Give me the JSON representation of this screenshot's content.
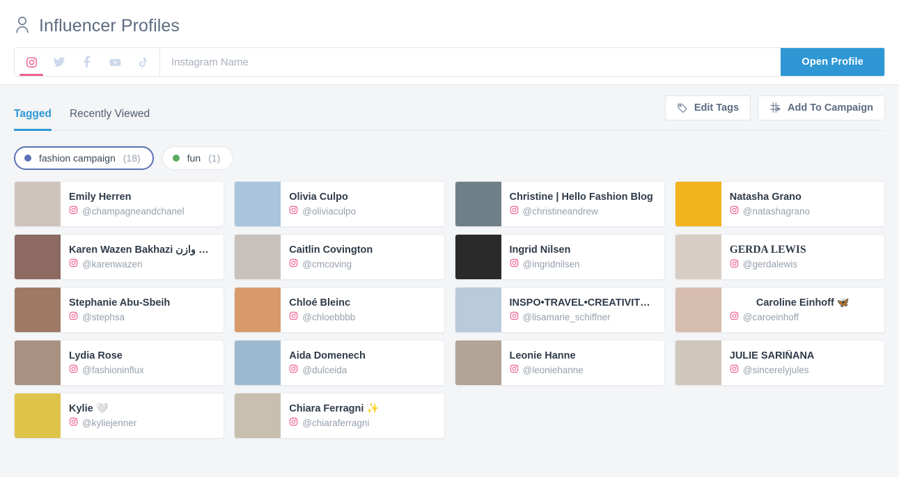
{
  "header": {
    "title": "Influencer Profiles",
    "title_icon": "person-icon"
  },
  "search": {
    "placeholder": "Instagram Name",
    "value": "",
    "open_profile_label": "Open Profile",
    "accent_color": "#2e97d4",
    "networks": [
      {
        "name": "instagram",
        "label": "Instagram",
        "active": true,
        "color": "#f06292"
      },
      {
        "name": "twitter",
        "label": "Twitter",
        "active": false,
        "color": "#ccd8ea"
      },
      {
        "name": "facebook",
        "label": "Facebook",
        "active": false,
        "color": "#ccd8ea"
      },
      {
        "name": "youtube",
        "label": "YouTube",
        "active": false,
        "color": "#ccd8ea"
      },
      {
        "name": "tiktok",
        "label": "TikTok",
        "active": false,
        "color": "#ccd8ea"
      }
    ]
  },
  "tabs": [
    {
      "label": "Tagged",
      "active": true
    },
    {
      "label": "Recently Viewed",
      "active": false
    }
  ],
  "actions": [
    {
      "label": "Edit Tags",
      "icon": "tag-icon"
    },
    {
      "label": "Add To Campaign",
      "icon": "campaign-icon"
    }
  ],
  "tag_filters": [
    {
      "label": "fashion campaign",
      "count": "(18)",
      "color": "#5a6fb5",
      "selected": true
    },
    {
      "label": "fun",
      "count": "(1)",
      "color": "#5cab62",
      "selected": false
    }
  ],
  "profiles": [
    {
      "name": "Emily Herren",
      "handle": "@champagneandchanel",
      "network_icon": "instagram-icon",
      "style": "normal",
      "avatar": "#cfc4bd"
    },
    {
      "name": "Olivia Culpo",
      "handle": "@oliviaculpo",
      "network_icon": "instagram-icon",
      "style": "normal",
      "avatar": "#a9c4dc"
    },
    {
      "name": "Christine | Hello Fashion Blog",
      "handle": "@christineandrew",
      "network_icon": "instagram-icon",
      "style": "normal",
      "avatar": "#6f7f88"
    },
    {
      "name": "Natasha Grano",
      "handle": "@natashagrano",
      "network_icon": "instagram-icon",
      "style": "normal",
      "avatar": "#f2b31c"
    },
    {
      "name": "Karen Wazen Bakhazi كارن وازن...",
      "handle": "@karenwazen",
      "network_icon": "instagram-icon",
      "style": "normal",
      "avatar": "#8c6a62"
    },
    {
      "name": "Caitlin Covington",
      "handle": "@cmcoving",
      "network_icon": "instagram-icon",
      "style": "normal",
      "avatar": "#c8c0bb"
    },
    {
      "name": "Ingrid Nilsen",
      "handle": "@ingridnilsen",
      "network_icon": "instagram-icon",
      "style": "normal",
      "avatar": "#2a2a2a"
    },
    {
      "name": "GERDA LEWIS",
      "handle": "@gerdalewis",
      "network_icon": "instagram-icon",
      "style": "serif",
      "avatar": "#d8cdc4"
    },
    {
      "name": "Stephanie Abu-Sbeih",
      "handle": "@stephsa",
      "network_icon": "instagram-icon",
      "style": "normal",
      "avatar": "#9e7a66"
    },
    {
      "name": "Chloé Bleinc",
      "handle": "@chloebbbb",
      "network_icon": "instagram-icon",
      "style": "normal",
      "avatar": "#d89a6a"
    },
    {
      "name": "INSPO•TRAVEL•CREATIVITY•...",
      "handle": "@lisamarie_schiffner",
      "network_icon": "instagram-icon",
      "style": "normal",
      "avatar": "#b8cadb"
    },
    {
      "name": "Caroline Einhoff 🦋",
      "handle": "@caroeinhoff",
      "network_icon": "instagram-icon",
      "style": "center",
      "avatar": "#d7bdae"
    },
    {
      "name": "Lydia Rose",
      "handle": "@fashioninflux",
      "network_icon": "instagram-icon",
      "style": "normal",
      "avatar": "#a89180"
    },
    {
      "name": "Aida Domenech",
      "handle": "@dulceida",
      "network_icon": "instagram-icon",
      "style": "normal",
      "avatar": "#9db9cf"
    },
    {
      "name": "Leonie Hanne",
      "handle": "@leoniehanne",
      "network_icon": "instagram-icon",
      "style": "normal",
      "avatar": "#b1a396"
    },
    {
      "name": "JULIE SARIÑANA",
      "handle": "@sincerelyjules",
      "network_icon": "instagram-icon",
      "style": "normal",
      "avatar": "#cfc6bc"
    },
    {
      "name": "Kylie 🤍",
      "handle": "@kyliejenner",
      "network_icon": "instagram-icon",
      "style": "normal",
      "avatar": "#e0c34a"
    },
    {
      "name": "Chiara Ferragni ✨",
      "handle": "@chiaraferragni",
      "network_icon": "instagram-icon",
      "style": "normal",
      "avatar": "#c9bfae"
    }
  ]
}
